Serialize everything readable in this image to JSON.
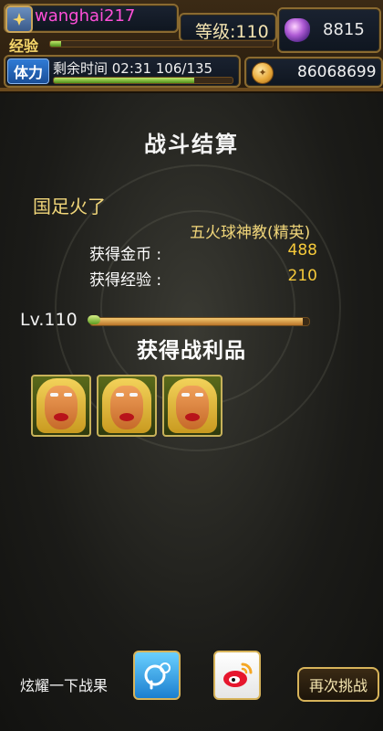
{
  "hud": {
    "username": "wanghai217",
    "level_text": "等级:110",
    "exp_label": "经验",
    "exp_progress": 0.05,
    "gem_value": "8815",
    "stamina_label": "体力",
    "stamina_text": "剩余时间  02:31  106/135",
    "stamina_progress": 0.785,
    "coin_value": "86068699",
    "colors": {
      "username": "#ff4fd8",
      "gold_text": "#f2d77a"
    }
  },
  "battle": {
    "title": "战斗结算",
    "player_name": "国足火了",
    "enemy_name": "五火球神教(精英)",
    "gold_label": "获得金币 :",
    "gold_value": "488",
    "exp_label": "获得经验 :",
    "exp_value": "210",
    "level_label": "Lv.110",
    "level_progress": 0.97,
    "loot_title": "获得战利品",
    "loot_items": [
      {
        "icon": "blonde-face-mask-icon"
      },
      {
        "icon": "blonde-face-mask-icon"
      },
      {
        "icon": "blonde-face-mask-icon"
      }
    ]
  },
  "footer": {
    "share_label": "炫耀一下战果",
    "share_icons": [
      "qq-share-icon",
      "weibo-share-icon"
    ],
    "retry_label": "再次挑战"
  }
}
